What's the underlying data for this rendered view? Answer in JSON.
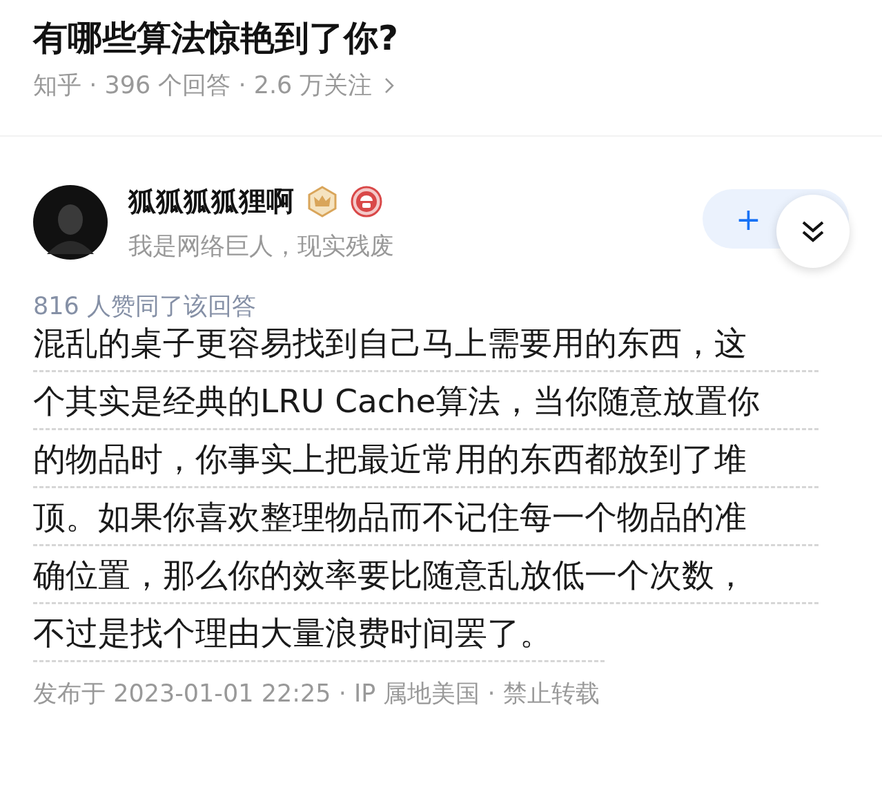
{
  "question": {
    "title": "有哪些算法惊艳到了你?",
    "meta": "知乎 · 396 个回答 · 2.6 万关注"
  },
  "author": {
    "name": "狐狐狐狐狸啊",
    "bio": "我是网络巨人，现实残废",
    "follow_label": "+"
  },
  "upvotes": "816 人赞同了该回答",
  "answer_lines": [
    "混乱的桌子更容易找到自己马上需要用的东西，这",
    "个其实是经典的LRU Cache算法，当你随意放置你",
    "的物品时，你事实上把最近常用的东西都放到了堆",
    "顶。如果你喜欢整理物品而不记住每一个物品的准",
    "确位置，那么你的效率要比随意乱放低一个次数，",
    "不过是找个理由大量浪费时间罢了。"
  ],
  "footer": "发布于 2023-01-01 22:25 · IP 属地美国 · 禁止转载"
}
